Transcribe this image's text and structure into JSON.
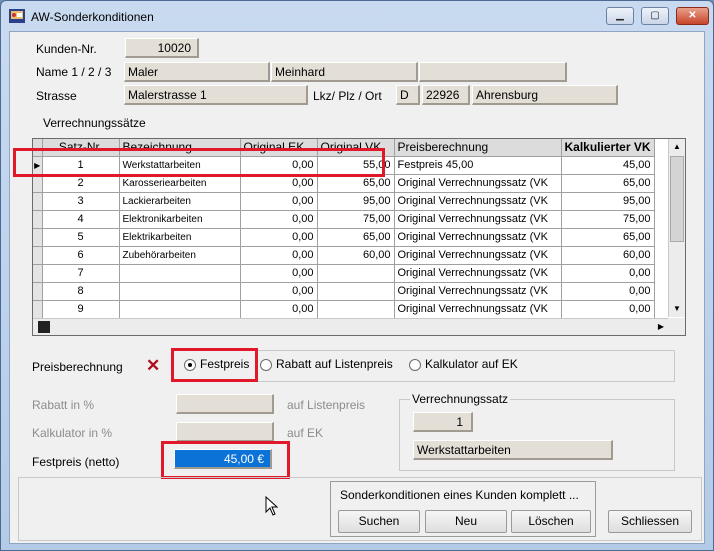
{
  "window": {
    "title": "AW-Sonderkonditionen"
  },
  "customer": {
    "number_label": "Kunden-Nr.",
    "number": "10020",
    "name_label": "Name 1 / 2 / 3",
    "name1": "Maler",
    "name2": "Meinhard",
    "name3": "",
    "street_label": "Strasse",
    "street": "Malerstrasse 1",
    "lkz_label": "Lkz/ Plz / Ort",
    "lkz": "D",
    "plz": "22926",
    "city": "Ahrensburg"
  },
  "rates": {
    "section_label": "Verrechnungssätze",
    "columns": [
      "Satz-Nr.",
      "Bezeichnung",
      "Original EK",
      "Original VK",
      "Preisberechnung",
      "Kalkulierter VK"
    ],
    "rows": [
      [
        "1",
        "Werkstattarbeiten",
        "0,00",
        "55,00",
        "Festpreis 45,00",
        "45,00"
      ],
      [
        "2",
        "Karosseriearbeiten",
        "0,00",
        "65,00",
        "Original Verrechnungssatz (VK",
        "65,00"
      ],
      [
        "3",
        "Lackierarbeiten",
        "0,00",
        "95,00",
        "Original Verrechnungssatz (VK",
        "95,00"
      ],
      [
        "4",
        "Elektronikarbeiten",
        "0,00",
        "75,00",
        "Original Verrechnungssatz (VK",
        "75,00"
      ],
      [
        "5",
        "Elektrikarbeiten",
        "0,00",
        "65,00",
        "Original Verrechnungssatz (VK",
        "65,00"
      ],
      [
        "6",
        "Zubehörarbeiten",
        "0,00",
        "60,00",
        "Original Verrechnungssatz (VK",
        "60,00"
      ],
      [
        "7",
        "",
        "0,00",
        "",
        "Original Verrechnungssatz (VK",
        "0,00"
      ],
      [
        "8",
        "",
        "0,00",
        "",
        "Original Verrechnungssatz (VK",
        "0,00"
      ],
      [
        "9",
        "",
        "0,00",
        "",
        "Original Verrechnungssatz (VK",
        "0,00"
      ]
    ]
  },
  "pricing": {
    "label": "Preisberechnung",
    "options": [
      "Festpreis",
      "Rabatt auf Listenpreis",
      "Kalkulator auf EK"
    ],
    "selected": "Festpreis",
    "discount_label": "Rabatt in %",
    "discount_suffix": "auf Listenpreis",
    "discount_value": "",
    "calc_label": "Kalkulator in %",
    "calc_suffix": "auf EK",
    "calc_value": "",
    "fixed_label": "Festpreis (netto)",
    "fixed_value": "45,00 €"
  },
  "rate_box": {
    "label": "Verrechnungssatz",
    "number": "1",
    "name": "Werkstattarbeiten"
  },
  "actions": {
    "group_label": "Sonderkonditionen eines Kunden komplett ...",
    "search": "Suchen",
    "new": "Neu",
    "delete": "Löschen",
    "close": "Schliessen"
  },
  "colors": {
    "highlight": "#e0182a",
    "selected_field": "#0b72d8"
  }
}
